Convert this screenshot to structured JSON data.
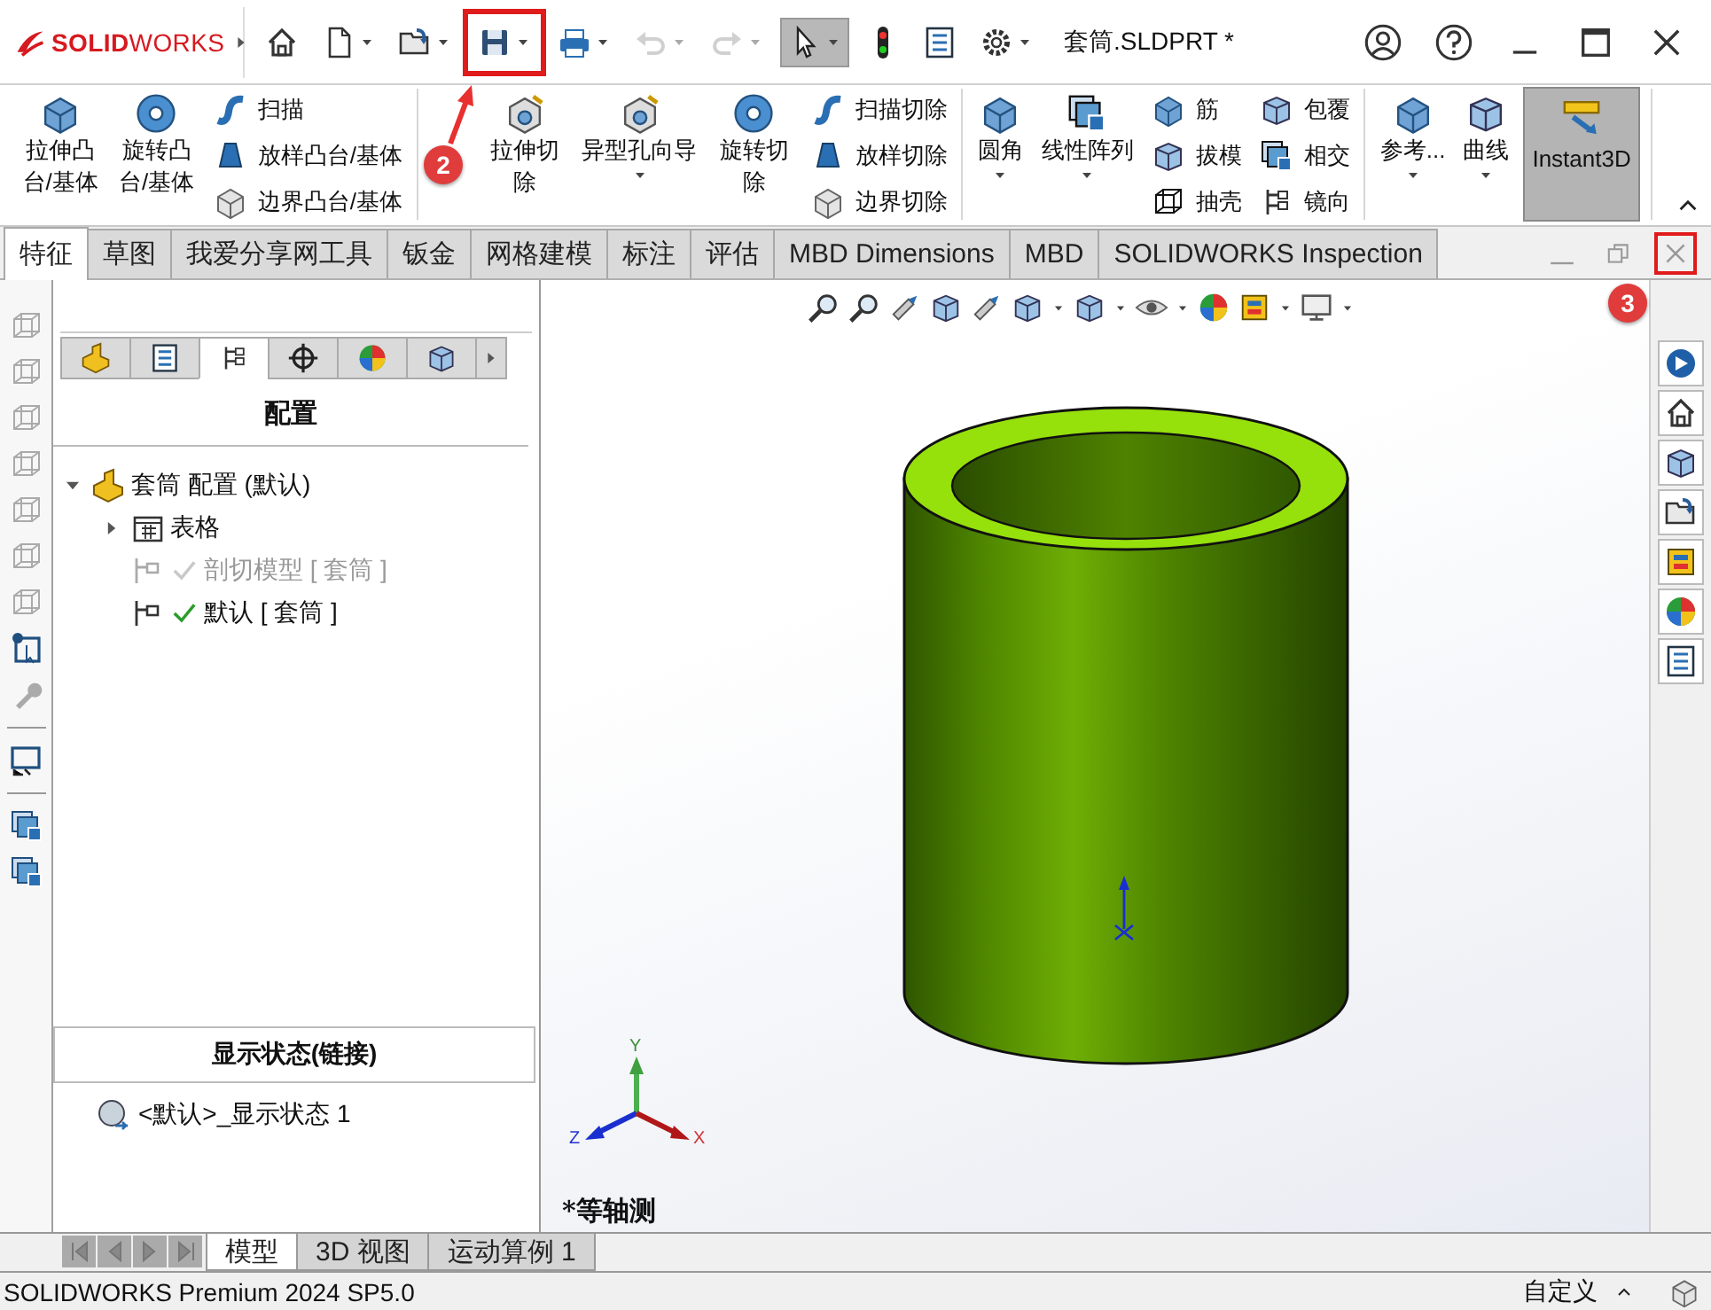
{
  "title_bar": {
    "logo": "**SOLID**WORKS",
    "document_title": "套筒.SLDPRT *",
    "quick_access": [
      {
        "kind": "home",
        "dropdown": false,
        "disabled": false,
        "pressed": false,
        "highlighted": false
      },
      {
        "kind": "new",
        "dropdown": true,
        "disabled": false,
        "pressed": false,
        "highlighted": false
      },
      {
        "kind": "open",
        "dropdown": true,
        "disabled": false,
        "pressed": false,
        "highlighted": false
      },
      {
        "kind": "save",
        "dropdown": true,
        "disabled": false,
        "pressed": false,
        "highlighted": true
      },
      {
        "kind": "print",
        "dropdown": true,
        "disabled": false,
        "pressed": false,
        "highlighted": false
      },
      {
        "kind": "undo",
        "dropdown": true,
        "disabled": true,
        "pressed": false,
        "highlighted": false
      },
      {
        "kind": "redo",
        "dropdown": true,
        "disabled": true,
        "pressed": false,
        "highlighted": false
      },
      {
        "kind": "select",
        "dropdown": true,
        "disabled": false,
        "pressed": true,
        "highlighted": false
      },
      {
        "kind": "rebuild",
        "dropdown": false,
        "disabled": false,
        "pressed": false,
        "highlighted": false
      },
      {
        "kind": "file_properties",
        "dropdown": false,
        "disabled": false,
        "pressed": false,
        "highlighted": false
      },
      {
        "kind": "options",
        "dropdown": true,
        "disabled": false,
        "pressed": false,
        "highlighted": false
      }
    ]
  },
  "ribbon": {
    "groups": [
      {
        "items": [
          {
            "kind": "large",
            "label": "拉伸凸台/基体",
            "dropdown": false
          },
          {
            "kind": "large",
            "label": "旋转凸台/基体",
            "dropdown": false
          },
          {
            "kind": "stack",
            "items": [
              "扫描",
              "放样凸台/基体",
              "边界凸台/基体"
            ]
          }
        ]
      },
      {
        "items": [
          {
            "kind": "large",
            "label": "拉伸切除",
            "dropdown": false
          },
          {
            "kind": "large",
            "label": "异型孔向导",
            "dropdown": true
          },
          {
            "kind": "large",
            "label": "旋转切除",
            "dropdown": false
          },
          {
            "kind": "stack",
            "items": [
              "扫描切除",
              "放样切除",
              "边界切除"
            ]
          }
        ]
      },
      {
        "items": [
          {
            "kind": "large",
            "label": "圆角",
            "dropdown": true
          },
          {
            "kind": "large",
            "label": "线性阵列",
            "dropdown": true
          },
          {
            "kind": "stack",
            "items": [
              "筋",
              "拔模",
              "抽壳"
            ]
          },
          {
            "kind": "stack",
            "items": [
              "包覆",
              "相交",
              "镜向"
            ]
          }
        ]
      },
      {
        "items": [
          {
            "kind": "large",
            "label": "参考...",
            "dropdown": true
          },
          {
            "kind": "large",
            "label": "曲线",
            "dropdown": true
          },
          {
            "kind": "toggle",
            "label": "Instant3D",
            "pressed": true
          }
        ]
      }
    ]
  },
  "tabs": [
    {
      "label": "特征",
      "selected": true
    },
    {
      "label": "草图",
      "selected": false
    },
    {
      "label": "我爱分享网工具",
      "selected": false
    },
    {
      "label": "钣金",
      "selected": false
    },
    {
      "label": "网格建模",
      "selected": false
    },
    {
      "label": "标注",
      "selected": false
    },
    {
      "label": "评估",
      "selected": false
    },
    {
      "label": "MBD Dimensions",
      "selected": false
    },
    {
      "label": "MBD",
      "selected": false
    },
    {
      "label": "SOLIDWORKS Inspection",
      "selected": false
    }
  ],
  "document_window_controls": [
    {
      "kind": "minimize",
      "highlighted": false
    },
    {
      "kind": "restore",
      "highlighted": false
    },
    {
      "kind": "close",
      "highlighted": true
    }
  ],
  "left_tools": [
    {
      "disabled": true
    },
    {
      "disabled": true
    },
    {
      "disabled": true
    },
    {
      "disabled": true
    },
    {
      "disabled": true
    },
    {
      "disabled": true
    },
    {
      "disabled": true
    },
    {
      "disabled": false
    },
    {
      "disabled": true
    },
    {
      "disabled": false
    },
    {
      "disabled": false
    },
    {
      "disabled": false
    }
  ],
  "feature_manager": {
    "panel_tabs": [
      {
        "selected": false
      },
      {
        "selected": false
      },
      {
        "selected": true
      },
      {
        "selected": false
      },
      {
        "selected": false
      },
      {
        "selected": false
      }
    ],
    "heading": "配置",
    "tree": [
      {
        "kind": "part",
        "label": "套筒 配置 (默认)",
        "expanded": true,
        "children": [
          {
            "kind": "folder",
            "label": "表格",
            "expanded": false
          },
          {
            "kind": "config",
            "label": "剖切模型 [ 套筒 ]",
            "active": false
          },
          {
            "kind": "config",
            "label": "默认 [ 套筒 ]",
            "active": true
          }
        ]
      }
    ],
    "display_states": {
      "heading": "显示状态(链接)",
      "items": [
        {
          "label": "<默认>_显示状态 1"
        }
      ]
    }
  },
  "viewport": {
    "triad": {
      "y": "Y",
      "z": "Z",
      "x": "X"
    },
    "view_label": "*等轴测"
  },
  "bottom_tabs": [
    {
      "label": "模型",
      "selected": true
    },
    {
      "label": "3D 视图",
      "selected": false
    },
    {
      "label": "运动算例 1",
      "selected": false
    }
  ],
  "status_bar": {
    "product": "SOLIDWORKS Premium 2024 SP5.0",
    "units": "自定义"
  },
  "annotations": [
    {
      "label": "2"
    },
    {
      "label": "3"
    }
  ]
}
